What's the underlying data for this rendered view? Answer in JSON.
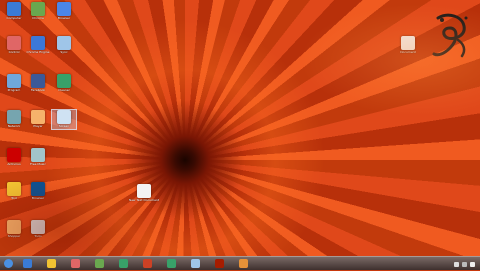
{
  "desktop_icons": [
    {
      "label": "Computer",
      "color": "#3a7bd5"
    },
    {
      "label": "Chrome",
      "color": "#6aa84f"
    },
    {
      "label": "Browser",
      "color": "#4a86e8"
    },
    {
      "label": "Control",
      "color": "#e06666"
    },
    {
      "label": "Chrome Engine",
      "color": "#3c78d8"
    },
    {
      "label": "Sync",
      "color": "#9fc5e8"
    },
    {
      "label": "Program",
      "color": "#6fa8dc"
    },
    {
      "label": "Facebook",
      "color": "#3b5998"
    },
    {
      "label": "Cleaner",
      "color": "#38a169"
    },
    {
      "label": "Network",
      "color": "#76a5af"
    },
    {
      "label": "Player",
      "color": "#f6b26b"
    },
    {
      "label": "Screen",
      "color": "#cfe2f3"
    },
    {
      "label": "Antivirus",
      "color": "#cc0000"
    },
    {
      "label": "Free Music",
      "color": "#a2c4c9"
    },
    {
      "label": "Tool",
      "color": "#f1c232"
    },
    {
      "label": "Browser",
      "color": "#0b5394"
    },
    {
      "label": "Shopper",
      "color": "#f6b26b"
    },
    {
      "label": "Tools",
      "color": "#d9d9d9"
    },
    {
      "label": "New Text Document",
      "color": "#f3f3f3"
    },
    {
      "label": "Document",
      "color": "#efefef"
    }
  ],
  "calligraphy_color": "#1a1a1a",
  "taskbar_items": [
    {
      "name": "start",
      "color": "#4a90e2"
    },
    {
      "name": "ie",
      "color": "#3a7bd5"
    },
    {
      "name": "folder",
      "color": "#f1c232"
    },
    {
      "name": "media",
      "color": "#e06666"
    },
    {
      "name": "chrome",
      "color": "#6aa84f"
    },
    {
      "name": "ccleaner",
      "color": "#38a169"
    },
    {
      "name": "app",
      "color": "#cc4125"
    },
    {
      "name": "ccleaner2",
      "color": "#38a169"
    },
    {
      "name": "player",
      "color": "#9fc5e8"
    },
    {
      "name": "app2",
      "color": "#a61c00"
    },
    {
      "name": "app3",
      "color": "#e69138"
    }
  ],
  "clock": {
    "time": "",
    "date": ""
  }
}
